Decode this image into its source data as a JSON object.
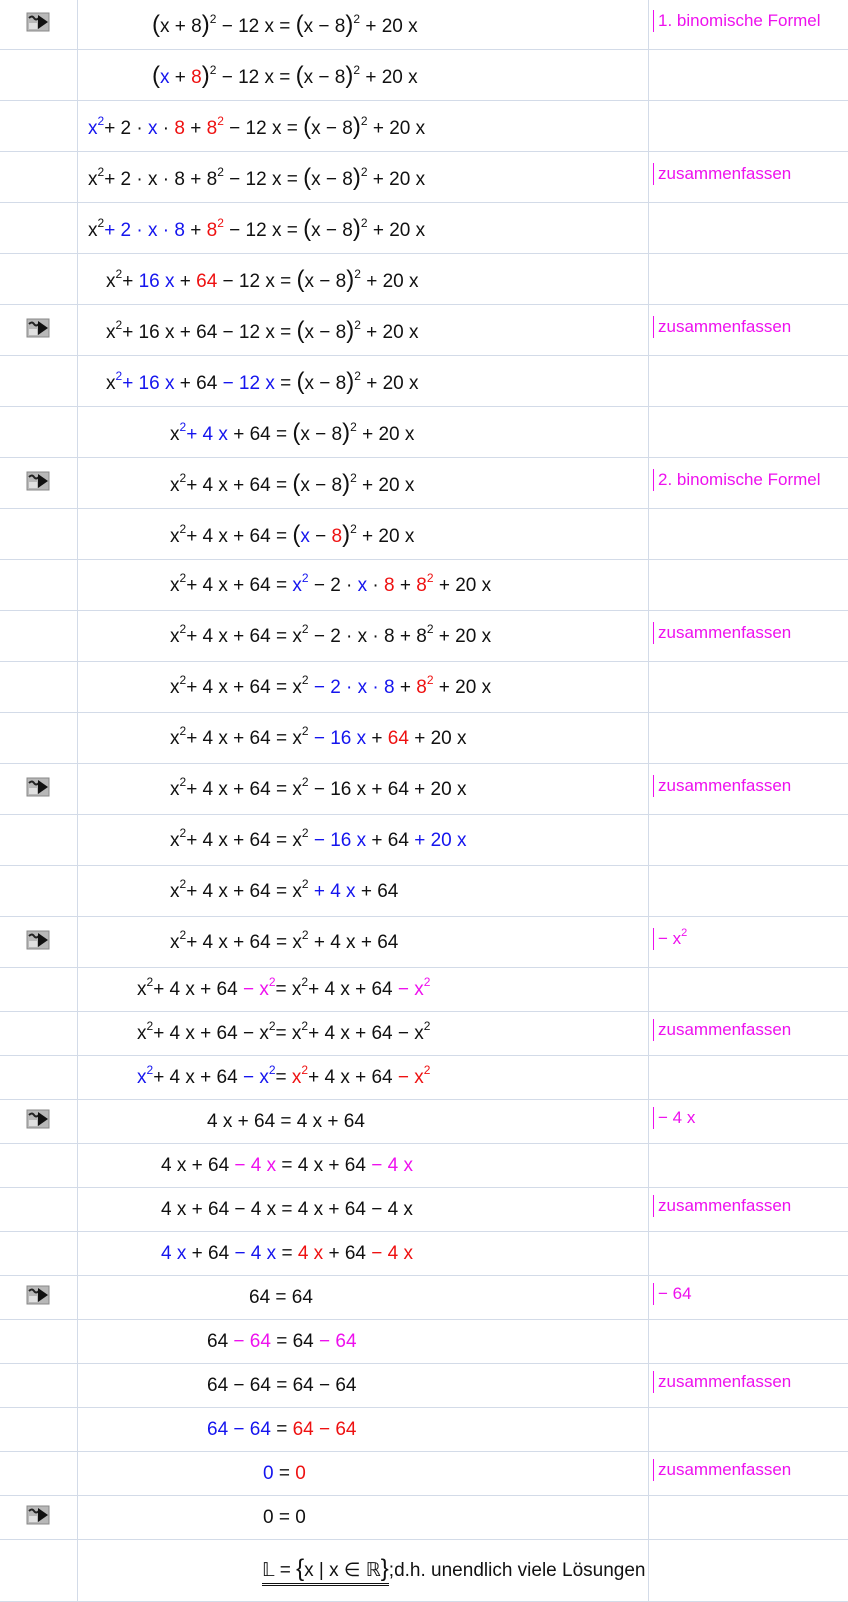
{
  "annotations": {
    "binom1": "1. binomische Formel",
    "zus": "zusammenfassen",
    "binom2": "2. binomische Formel",
    "minus_x2_prefix": "− x",
    "minus_x2_exp": "2",
    "minus_4x": "− 4 x",
    "minus_64": "− 64"
  },
  "rows": [
    {
      "icon": true,
      "note": "binom1"
    },
    {
      "icon": false,
      "note": null
    },
    {
      "icon": false,
      "note": null
    },
    {
      "icon": false,
      "note": "zus"
    },
    {
      "icon": false,
      "note": null
    },
    {
      "icon": false,
      "note": null
    },
    {
      "icon": true,
      "note": "zus"
    },
    {
      "icon": false,
      "note": null
    },
    {
      "icon": false,
      "note": null
    },
    {
      "icon": true,
      "note": "binom2"
    },
    {
      "icon": false,
      "note": null
    },
    {
      "icon": false,
      "note": null
    },
    {
      "icon": false,
      "note": "zus"
    },
    {
      "icon": false,
      "note": null
    },
    {
      "icon": false,
      "note": null
    },
    {
      "icon": true,
      "note": "zus"
    },
    {
      "icon": false,
      "note": null
    },
    {
      "icon": false,
      "note": null
    },
    {
      "icon": true,
      "note": "minus_x2"
    },
    {
      "icon": false,
      "note": null
    },
    {
      "icon": false,
      "note": "zus"
    },
    {
      "icon": false,
      "note": null
    },
    {
      "icon": true,
      "note": "minus_4x"
    },
    {
      "icon": false,
      "note": null
    },
    {
      "icon": false,
      "note": "zus"
    },
    {
      "icon": false,
      "note": null
    },
    {
      "icon": true,
      "note": "minus_64"
    },
    {
      "icon": false,
      "note": null
    },
    {
      "icon": false,
      "note": "zus"
    },
    {
      "icon": false,
      "note": null
    },
    {
      "icon": false,
      "note": "zus"
    },
    {
      "icon": true,
      "note": null
    },
    {
      "icon": false,
      "note": null
    }
  ],
  "equations": [
    [
      [
        "k",
        "par",
        "("
      ],
      [
        "k",
        "t",
        "x + 8"
      ],
      [
        "k",
        "par",
        ")"
      ],
      [
        "k",
        "sup",
        "2"
      ],
      [
        "k",
        "t",
        " − 12 x = "
      ],
      [
        "k",
        "par",
        "("
      ],
      [
        "k",
        "t",
        "x − 8"
      ],
      [
        "k",
        "par",
        ")"
      ],
      [
        "k",
        "sup",
        "2"
      ],
      [
        "k",
        "t",
        " + 20 x"
      ]
    ],
    [
      [
        "k",
        "par",
        "("
      ],
      [
        "b",
        "t",
        "x"
      ],
      [
        "k",
        "t",
        " + "
      ],
      [
        "r",
        "t",
        "8"
      ],
      [
        "k",
        "par",
        ")"
      ],
      [
        "k",
        "sup",
        "2"
      ],
      [
        "k",
        "t",
        " − 12 x = "
      ],
      [
        "k",
        "par",
        "("
      ],
      [
        "k",
        "t",
        "x − 8"
      ],
      [
        "k",
        "par",
        ")"
      ],
      [
        "k",
        "sup",
        "2"
      ],
      [
        "k",
        "t",
        " + 20 x"
      ]
    ],
    [
      [
        "b",
        "t",
        "x"
      ],
      [
        "b",
        "sup",
        "2"
      ],
      [
        "k",
        "t",
        "+ 2 · "
      ],
      [
        "b",
        "t",
        "x"
      ],
      [
        "k",
        "t",
        " · "
      ],
      [
        "r",
        "t",
        "8"
      ],
      [
        "k",
        "t",
        " + "
      ],
      [
        "r",
        "t",
        "8"
      ],
      [
        "r",
        "sup",
        "2"
      ],
      [
        "k",
        "t",
        " − 12 x = "
      ],
      [
        "k",
        "par",
        "("
      ],
      [
        "k",
        "t",
        "x − 8"
      ],
      [
        "k",
        "par",
        ")"
      ],
      [
        "k",
        "sup",
        "2"
      ],
      [
        "k",
        "t",
        " + 20 x"
      ]
    ],
    [
      [
        "k",
        "t",
        "x"
      ],
      [
        "k",
        "sup",
        "2"
      ],
      [
        "k",
        "t",
        "+ 2 · x · 8 + 8"
      ],
      [
        "k",
        "sup",
        "2"
      ],
      [
        "k",
        "t",
        " − 12 x = "
      ],
      [
        "k",
        "par",
        "("
      ],
      [
        "k",
        "t",
        "x − 8"
      ],
      [
        "k",
        "par",
        ")"
      ],
      [
        "k",
        "sup",
        "2"
      ],
      [
        "k",
        "t",
        " + 20 x"
      ]
    ],
    [
      [
        "k",
        "t",
        "x"
      ],
      [
        "k",
        "sup",
        "2"
      ],
      [
        "b",
        "t",
        "+ 2 · x · 8"
      ],
      [
        "k",
        "t",
        " + "
      ],
      [
        "r",
        "t",
        "8"
      ],
      [
        "r",
        "sup",
        "2"
      ],
      [
        "k",
        "t",
        " − 12 x = "
      ],
      [
        "k",
        "par",
        "("
      ],
      [
        "k",
        "t",
        "x − 8"
      ],
      [
        "k",
        "par",
        ")"
      ],
      [
        "k",
        "sup",
        "2"
      ],
      [
        "k",
        "t",
        " + 20 x"
      ]
    ],
    [
      [
        "k",
        "t",
        "x"
      ],
      [
        "k",
        "sup",
        "2"
      ],
      [
        "k",
        "t",
        "+ "
      ],
      [
        "b",
        "t",
        "16 x"
      ],
      [
        "k",
        "t",
        " + "
      ],
      [
        "r",
        "t",
        "64"
      ],
      [
        "k",
        "t",
        " − 12 x = "
      ],
      [
        "k",
        "par",
        "("
      ],
      [
        "k",
        "t",
        "x − 8"
      ],
      [
        "k",
        "par",
        ")"
      ],
      [
        "k",
        "sup",
        "2"
      ],
      [
        "k",
        "t",
        " + 20 x"
      ]
    ],
    [
      [
        "k",
        "t",
        "x"
      ],
      [
        "k",
        "sup",
        "2"
      ],
      [
        "k",
        "t",
        "+ 16 x + 64 − 12 x = "
      ],
      [
        "k",
        "par",
        "("
      ],
      [
        "k",
        "t",
        "x − 8"
      ],
      [
        "k",
        "par",
        ")"
      ],
      [
        "k",
        "sup",
        "2"
      ],
      [
        "k",
        "t",
        " + 20 x"
      ]
    ],
    [
      [
        "k",
        "t",
        "x"
      ],
      [
        "b",
        "sup",
        "2"
      ],
      [
        "b",
        "t",
        "+ 16 x"
      ],
      [
        "k",
        "t",
        " + 64 "
      ],
      [
        "b",
        "t",
        "− 12 x"
      ],
      [
        "k",
        "t",
        " = "
      ],
      [
        "k",
        "par",
        "("
      ],
      [
        "k",
        "t",
        "x − 8"
      ],
      [
        "k",
        "par",
        ")"
      ],
      [
        "k",
        "sup",
        "2"
      ],
      [
        "k",
        "t",
        " + 20 x"
      ]
    ],
    [
      [
        "k",
        "t",
        "x"
      ],
      [
        "b",
        "sup",
        "2"
      ],
      [
        "b",
        "t",
        "+ 4 x"
      ],
      [
        "k",
        "t",
        " + 64 = "
      ],
      [
        "k",
        "par",
        "("
      ],
      [
        "k",
        "t",
        "x − 8"
      ],
      [
        "k",
        "par",
        ")"
      ],
      [
        "k",
        "sup",
        "2"
      ],
      [
        "k",
        "t",
        " + 20 x"
      ]
    ],
    [
      [
        "k",
        "t",
        "x"
      ],
      [
        "k",
        "sup",
        "2"
      ],
      [
        "k",
        "t",
        "+ 4 x + 64 = "
      ],
      [
        "k",
        "par",
        "("
      ],
      [
        "k",
        "t",
        "x − 8"
      ],
      [
        "k",
        "par",
        ")"
      ],
      [
        "k",
        "sup",
        "2"
      ],
      [
        "k",
        "t",
        " + 20 x"
      ]
    ],
    [
      [
        "k",
        "t",
        "x"
      ],
      [
        "k",
        "sup",
        "2"
      ],
      [
        "k",
        "t",
        "+ 4 x + 64 = "
      ],
      [
        "k",
        "par",
        "("
      ],
      [
        "b",
        "t",
        "x"
      ],
      [
        "k",
        "t",
        " − "
      ],
      [
        "r",
        "t",
        "8"
      ],
      [
        "k",
        "par",
        ")"
      ],
      [
        "k",
        "sup",
        "2"
      ],
      [
        "k",
        "t",
        " + 20 x"
      ]
    ],
    [
      [
        "k",
        "t",
        "x"
      ],
      [
        "k",
        "sup",
        "2"
      ],
      [
        "k",
        "t",
        "+ 4 x + 64 = "
      ],
      [
        "b",
        "t",
        "x"
      ],
      [
        "b",
        "sup",
        "2"
      ],
      [
        "k",
        "t",
        " − 2 · "
      ],
      [
        "b",
        "t",
        "x"
      ],
      [
        "k",
        "t",
        " · "
      ],
      [
        "r",
        "t",
        "8"
      ],
      [
        "k",
        "t",
        " + "
      ],
      [
        "r",
        "t",
        "8"
      ],
      [
        "r",
        "sup",
        "2"
      ],
      [
        "k",
        "t",
        " + 20 x"
      ]
    ],
    [
      [
        "k",
        "t",
        "x"
      ],
      [
        "k",
        "sup",
        "2"
      ],
      [
        "k",
        "t",
        "+ 4 x + 64 = x"
      ],
      [
        "k",
        "sup",
        "2"
      ],
      [
        "k",
        "t",
        " − 2 · x · 8 + 8"
      ],
      [
        "k",
        "sup",
        "2"
      ],
      [
        "k",
        "t",
        " + 20 x"
      ]
    ],
    [
      [
        "k",
        "t",
        "x"
      ],
      [
        "k",
        "sup",
        "2"
      ],
      [
        "k",
        "t",
        "+ 4 x + 64 = x"
      ],
      [
        "k",
        "sup",
        "2"
      ],
      [
        "k",
        "t",
        " "
      ],
      [
        "b",
        "t",
        "− 2 · x · 8"
      ],
      [
        "k",
        "t",
        " + "
      ],
      [
        "r",
        "t",
        "8"
      ],
      [
        "r",
        "sup",
        "2"
      ],
      [
        "k",
        "t",
        " + 20 x"
      ]
    ],
    [
      [
        "k",
        "t",
        "x"
      ],
      [
        "k",
        "sup",
        "2"
      ],
      [
        "k",
        "t",
        "+ 4 x + 64 = x"
      ],
      [
        "k",
        "sup",
        "2"
      ],
      [
        "k",
        "t",
        " "
      ],
      [
        "b",
        "t",
        "− 16 x"
      ],
      [
        "k",
        "t",
        " + "
      ],
      [
        "r",
        "t",
        "64"
      ],
      [
        "k",
        "t",
        " + 20 x"
      ]
    ],
    [
      [
        "k",
        "t",
        "x"
      ],
      [
        "k",
        "sup",
        "2"
      ],
      [
        "k",
        "t",
        "+ 4 x + 64 = x"
      ],
      [
        "k",
        "sup",
        "2"
      ],
      [
        "k",
        "t",
        " − 16 x + 64 + 20 x"
      ]
    ],
    [
      [
        "k",
        "t",
        "x"
      ],
      [
        "k",
        "sup",
        "2"
      ],
      [
        "k",
        "t",
        "+ 4 x + 64 = x"
      ],
      [
        "k",
        "sup",
        "2"
      ],
      [
        "k",
        "t",
        " "
      ],
      [
        "b",
        "t",
        "− 16 x"
      ],
      [
        "k",
        "t",
        " + 64 "
      ],
      [
        "b",
        "t",
        "+ 20 x"
      ]
    ],
    [
      [
        "k",
        "t",
        "x"
      ],
      [
        "k",
        "sup",
        "2"
      ],
      [
        "k",
        "t",
        "+ 4 x + 64 = x"
      ],
      [
        "k",
        "sup",
        "2"
      ],
      [
        "k",
        "t",
        " "
      ],
      [
        "b",
        "t",
        "+ 4 x"
      ],
      [
        "k",
        "t",
        " + 64"
      ]
    ],
    [
      [
        "k",
        "t",
        "x"
      ],
      [
        "k",
        "sup",
        "2"
      ],
      [
        "k",
        "t",
        "+ 4 x + 64 = x"
      ],
      [
        "k",
        "sup",
        "2"
      ],
      [
        "k",
        "t",
        " + 4 x + 64"
      ]
    ],
    [
      [
        "k",
        "t",
        "x"
      ],
      [
        "k",
        "sup",
        "2"
      ],
      [
        "k",
        "t",
        "+ 4 x + 64 "
      ],
      [
        "m",
        "t",
        "− x"
      ],
      [
        "m",
        "sup",
        "2"
      ],
      [
        "k",
        "t",
        "= x"
      ],
      [
        "k",
        "sup",
        "2"
      ],
      [
        "k",
        "t",
        "+ 4 x + 64 "
      ],
      [
        "m",
        "t",
        "− x"
      ],
      [
        "m",
        "sup",
        "2"
      ]
    ],
    [
      [
        "k",
        "t",
        "x"
      ],
      [
        "k",
        "sup",
        "2"
      ],
      [
        "k",
        "t",
        "+ 4 x + 64 − x"
      ],
      [
        "k",
        "sup",
        "2"
      ],
      [
        "k",
        "t",
        "= x"
      ],
      [
        "k",
        "sup",
        "2"
      ],
      [
        "k",
        "t",
        "+ 4 x + 64 − x"
      ],
      [
        "k",
        "sup",
        "2"
      ]
    ],
    [
      [
        "b",
        "t",
        "x"
      ],
      [
        "b",
        "sup",
        "2"
      ],
      [
        "k",
        "t",
        "+ 4 x + 64 "
      ],
      [
        "b",
        "t",
        "− x"
      ],
      [
        "b",
        "sup",
        "2"
      ],
      [
        "k",
        "t",
        "= "
      ],
      [
        "r",
        "t",
        "x"
      ],
      [
        "r",
        "sup",
        "2"
      ],
      [
        "k",
        "t",
        "+ 4 x + 64 "
      ],
      [
        "r",
        "t",
        "− x"
      ],
      [
        "r",
        "sup",
        "2"
      ]
    ],
    [
      [
        "k",
        "t",
        "4 x + 64 = 4 x + 64"
      ]
    ],
    [
      [
        "k",
        "t",
        "4 x + 64 "
      ],
      [
        "m",
        "t",
        "− 4 x"
      ],
      [
        "k",
        "t",
        " = 4 x + 64 "
      ],
      [
        "m",
        "t",
        "− 4 x"
      ]
    ],
    [
      [
        "k",
        "t",
        "4 x + 64 − 4 x = 4 x + 64 − 4 x"
      ]
    ],
    [
      [
        "b",
        "t",
        "4 x"
      ],
      [
        "k",
        "t",
        " + 64 "
      ],
      [
        "b",
        "t",
        "− 4 x"
      ],
      [
        "k",
        "t",
        " = "
      ],
      [
        "r",
        "t",
        "4 x"
      ],
      [
        "k",
        "t",
        " + 64 "
      ],
      [
        "r",
        "t",
        "− 4 x"
      ]
    ],
    [
      [
        "k",
        "t",
        "64 = 64"
      ]
    ],
    [
      [
        "k",
        "t",
        "64 "
      ],
      [
        "m",
        "t",
        "− 64"
      ],
      [
        "k",
        "t",
        " = 64 "
      ],
      [
        "m",
        "t",
        "− 64"
      ]
    ],
    [
      [
        "k",
        "t",
        "64 − 64 = 64 − 64"
      ]
    ],
    [
      [
        "b",
        "t",
        "64 − 64"
      ],
      [
        "k",
        "t",
        " = "
      ],
      [
        "r",
        "t",
        "64 − 64"
      ]
    ],
    [
      [
        "b",
        "t",
        "0"
      ],
      [
        "k",
        "t",
        " = "
      ],
      [
        "r",
        "t",
        "0"
      ]
    ],
    [
      [
        "k",
        "t",
        "0 = 0"
      ]
    ],
    [
      [
        "k",
        "t",
        "ℒ"
      ]
    ]
  ],
  "solution": {
    "set_symbol": "𝕃",
    "eq_sign": " = ",
    "open": "{",
    "var": "x",
    "bar": " | ",
    "cond": "x ∈ ℝ",
    "close": "}",
    "tail": ";d.h. unendlich viele Lösungen"
  },
  "colors": {
    "black": "#111111",
    "blue": "#1515ee",
    "red": "#ee1111",
    "magenta": "#ee11ee",
    "grid": "#d3dbe8"
  },
  "icon": "go-arrow-icon"
}
